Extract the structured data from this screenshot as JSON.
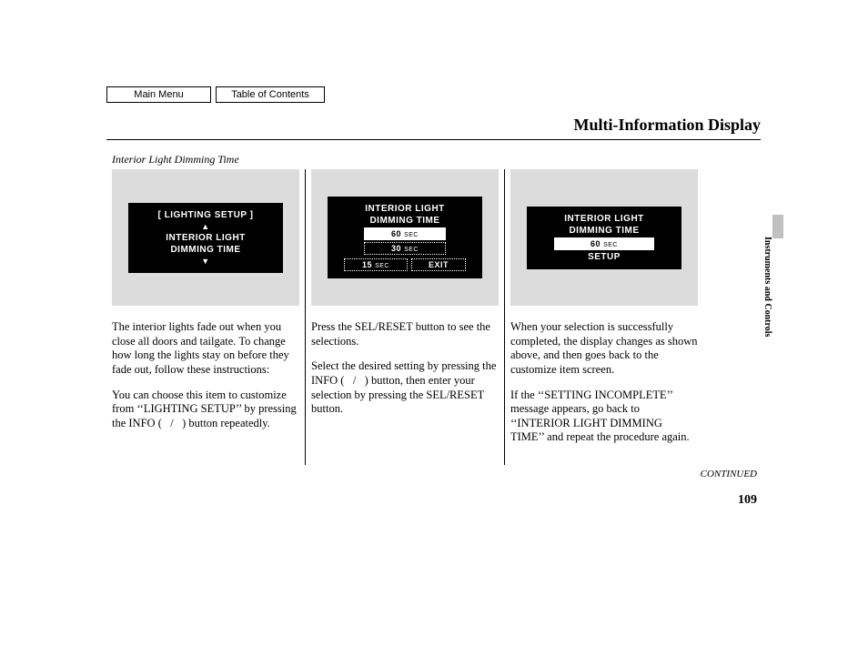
{
  "nav": {
    "main_menu": "Main Menu",
    "toc": "Table of Contents"
  },
  "page_title": "Multi-Information Display",
  "section_heading": "Interior Light Dimming Time",
  "side_label": "Instruments and Controls",
  "screen1": {
    "header": "[ LIGHTING SETUP ]",
    "line1": "INTERIOR LIGHT",
    "line2": "DIMMING TIME"
  },
  "screen2": {
    "line1": "INTERIOR LIGHT",
    "line2": "DIMMING TIME",
    "opt1_num": "60",
    "opt1_unit": "SEC",
    "opt2_num": "30",
    "opt2_unit": "SEC",
    "opt3_num": "15",
    "opt3_unit": "SEC",
    "exit": "EXIT"
  },
  "screen3": {
    "line1": "INTERIOR LIGHT",
    "line2": "DIMMING TIME",
    "sel_num": "60",
    "sel_unit": "SEC",
    "setup": "SETUP"
  },
  "col1": {
    "p1": "The interior lights fade out when you close all doors and tailgate. To change how long the lights stay on before they fade out, follow these instructions:",
    "p2": "You can choose this item to customize from ‘‘LIGHTING SETUP’’ by pressing the INFO (   /   ) button repeatedly."
  },
  "col2": {
    "p1": "Press the SEL/RESET button to see the selections.",
    "p2": "Select the desired setting by pressing the INFO (   /   ) button, then enter your selection by pressing the SEL/RESET button."
  },
  "col3": {
    "p1": "When your selection is successfully completed, the display changes as shown above, and then goes back to the customize item screen.",
    "p2": "If the ‘‘SETTING INCOMPLETE’’ message appears, go back to ‘‘INTERIOR LIGHT DIMMING TIME’’ and repeat the procedure again."
  },
  "continued": "CONTINUED",
  "page_number": "109"
}
